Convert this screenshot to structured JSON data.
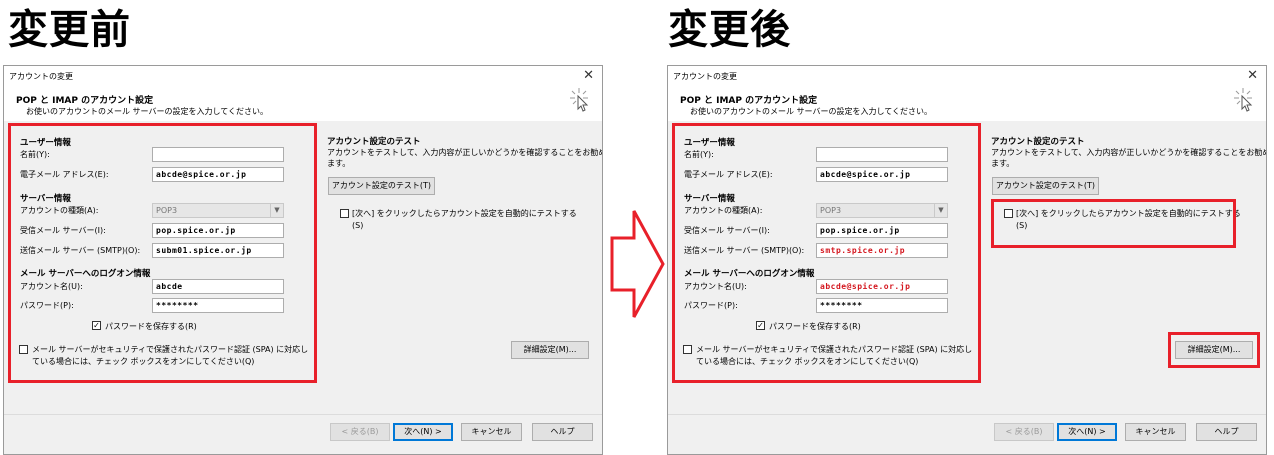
{
  "headings": {
    "before": "変更前",
    "after": "変更後"
  },
  "dialog": {
    "window_title": "アカウントの変更",
    "close": "✕",
    "header_title": "POP と IMAP のアカウント設定",
    "header_sub": "お使いのアカウントのメール サーバーの設定を入力してください。",
    "user_section": "ユーザー情報",
    "name_label": "名前(Y):",
    "email_label": "電子メール アドレス(E):",
    "server_section": "サーバー情報",
    "acct_type_label": "アカウントの種類(A):",
    "acct_type_value": "POP3",
    "incoming_label": "受信メール サーバー(I):",
    "outgoing_label": "送信メール サーバー (SMTP)(O):",
    "logon_section": "メール サーバーへのログオン情報",
    "account_label": "アカウント名(U):",
    "password_label": "パスワード(P):",
    "save_password": "パスワードを保存する(R)",
    "spa_line1": "メール サーバーがセキュリティで保護されたパスワード認証 (SPA) に対応し",
    "spa_line2": "ている場合には、チェック ボックスをオンにしてください(Q)",
    "test_section": "アカウント設定のテスト",
    "test_desc1": "アカウントをテストして、入力内容が正しいかどうかを確認することをお勧めし",
    "test_desc2": "ます。",
    "test_button": "アカウント設定のテスト(T)",
    "auto_test1": "[次へ] をクリックしたらアカウント設定を自動的にテストする",
    "auto_test2": "(S)",
    "detail_button": "詳細設定(M)...",
    "back_button": "< 戻る(B)",
    "next_button": "次へ(N) >",
    "cancel_button": "キャンセル",
    "help_button": "ヘルプ"
  },
  "before": {
    "name": "",
    "email": "abcde@spice.or.jp",
    "incoming": "pop.spice.or.jp",
    "outgoing": "subm01.spice.or.jp",
    "account": "abcde",
    "password": "********"
  },
  "after": {
    "name": "",
    "email": "abcde@spice.or.jp",
    "incoming": "pop.spice.or.jp",
    "outgoing": "smtp.spice.or.jp",
    "account": "abcde@spice.or.jp",
    "password": "********"
  },
  "colors": {
    "highlight": "#e8202a",
    "changed_text": "#d4171f"
  }
}
